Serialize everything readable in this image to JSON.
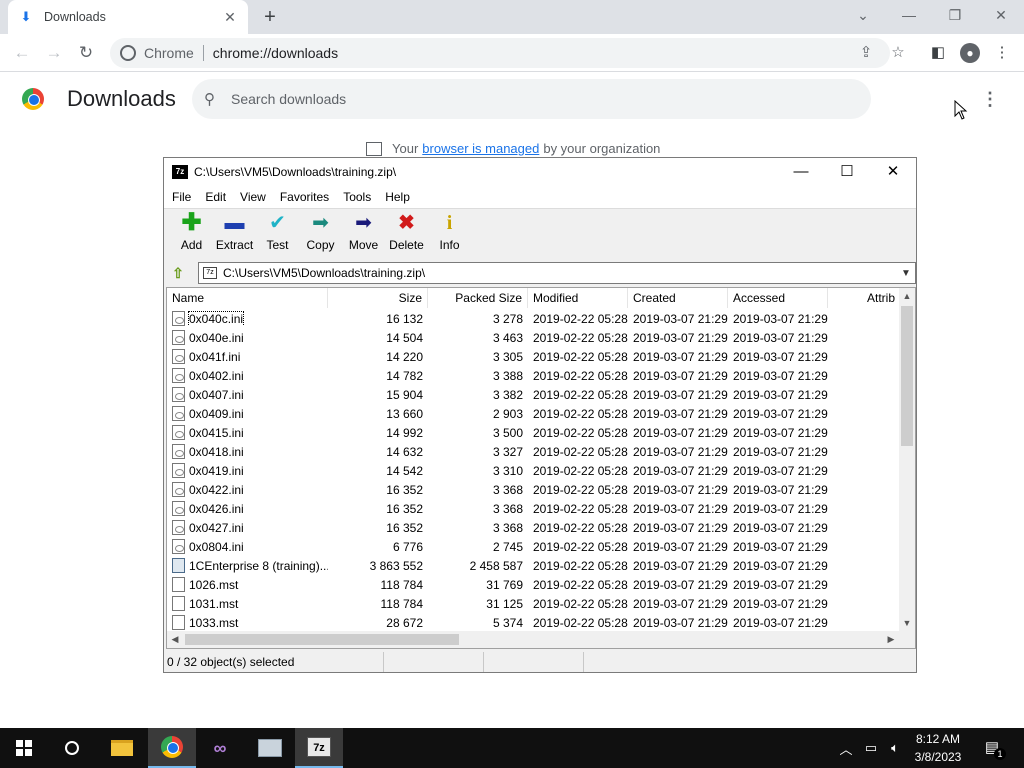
{
  "browser": {
    "tab_title": "Downloads",
    "newtab_symbol": "+",
    "omnibox_chip": "Chrome",
    "url": "chrome://downloads"
  },
  "downloads_page": {
    "title": "Downloads",
    "search_placeholder": "Search downloads",
    "managed_prefix": "Your",
    "managed_link": "browser is managed",
    "managed_suffix": "by your organization"
  },
  "sevenzip": {
    "title": "C:\\Users\\VM5\\Downloads\\training.zip\\",
    "menu": [
      "File",
      "Edit",
      "View",
      "Favorites",
      "Tools",
      "Help"
    ],
    "toolbar": [
      {
        "label": "Add",
        "icon": "plus-icon",
        "color": "#1aa31a"
      },
      {
        "label": "Extract",
        "icon": "minus-icon",
        "color": "#1e3fb0"
      },
      {
        "label": "Test",
        "icon": "check-icon",
        "color": "#1fb3c7"
      },
      {
        "label": "Copy",
        "icon": "double-arrow-icon",
        "color": "#1b8a7e"
      },
      {
        "label": "Move",
        "icon": "arrow-right-icon",
        "color": "#1a1a7a"
      },
      {
        "label": "Delete",
        "icon": "x-icon",
        "color": "#d11a1a"
      },
      {
        "label": "Info",
        "icon": "info-icon",
        "color": "#c9a400"
      }
    ],
    "path": "C:\\Users\\VM5\\Downloads\\training.zip\\",
    "columns": {
      "name": "Name",
      "size": "Size",
      "packed": "Packed Size",
      "modified": "Modified",
      "created": "Created",
      "accessed": "Accessed",
      "attrib": "Attrib"
    },
    "rows": [
      {
        "name": "0x040c.ini",
        "size": "16 132",
        "packed": "3 278",
        "modified": "2019-02-22 05:28",
        "created": "2019-03-07 21:29",
        "accessed": "2019-03-07 21:29",
        "type": "ini"
      },
      {
        "name": "0x040e.ini",
        "size": "14 504",
        "packed": "3 463",
        "modified": "2019-02-22 05:28",
        "created": "2019-03-07 21:29",
        "accessed": "2019-03-07 21:29",
        "type": "ini"
      },
      {
        "name": "0x041f.ini",
        "size": "14 220",
        "packed": "3 305",
        "modified": "2019-02-22 05:28",
        "created": "2019-03-07 21:29",
        "accessed": "2019-03-07 21:29",
        "type": "ini"
      },
      {
        "name": "0x0402.ini",
        "size": "14 782",
        "packed": "3 388",
        "modified": "2019-02-22 05:28",
        "created": "2019-03-07 21:29",
        "accessed": "2019-03-07 21:29",
        "type": "ini"
      },
      {
        "name": "0x0407.ini",
        "size": "15 904",
        "packed": "3 382",
        "modified": "2019-02-22 05:28",
        "created": "2019-03-07 21:29",
        "accessed": "2019-03-07 21:29",
        "type": "ini"
      },
      {
        "name": "0x0409.ini",
        "size": "13 660",
        "packed": "2 903",
        "modified": "2019-02-22 05:28",
        "created": "2019-03-07 21:29",
        "accessed": "2019-03-07 21:29",
        "type": "ini"
      },
      {
        "name": "0x0415.ini",
        "size": "14 992",
        "packed": "3 500",
        "modified": "2019-02-22 05:28",
        "created": "2019-03-07 21:29",
        "accessed": "2019-03-07 21:29",
        "type": "ini"
      },
      {
        "name": "0x0418.ini",
        "size": "14 632",
        "packed": "3 327",
        "modified": "2019-02-22 05:28",
        "created": "2019-03-07 21:29",
        "accessed": "2019-03-07 21:29",
        "type": "ini"
      },
      {
        "name": "0x0419.ini",
        "size": "14 542",
        "packed": "3 310",
        "modified": "2019-02-22 05:28",
        "created": "2019-03-07 21:29",
        "accessed": "2019-03-07 21:29",
        "type": "ini"
      },
      {
        "name": "0x0422.ini",
        "size": "16 352",
        "packed": "3 368",
        "modified": "2019-02-22 05:28",
        "created": "2019-03-07 21:29",
        "accessed": "2019-03-07 21:29",
        "type": "ini"
      },
      {
        "name": "0x0426.ini",
        "size": "16 352",
        "packed": "3 368",
        "modified": "2019-02-22 05:28",
        "created": "2019-03-07 21:29",
        "accessed": "2019-03-07 21:29",
        "type": "ini"
      },
      {
        "name": "0x0427.ini",
        "size": "16 352",
        "packed": "3 368",
        "modified": "2019-02-22 05:28",
        "created": "2019-03-07 21:29",
        "accessed": "2019-03-07 21:29",
        "type": "ini"
      },
      {
        "name": "0x0804.ini",
        "size": "6 776",
        "packed": "2 745",
        "modified": "2019-02-22 05:28",
        "created": "2019-03-07 21:29",
        "accessed": "2019-03-07 21:29",
        "type": "ini"
      },
      {
        "name": "1CEnterprise 8 (training)...",
        "size": "3 863 552",
        "packed": "2 458 587",
        "modified": "2019-02-22 05:28",
        "created": "2019-03-07 21:29",
        "accessed": "2019-03-07 21:29",
        "type": "pkg"
      },
      {
        "name": "1026.mst",
        "size": "118 784",
        "packed": "31 769",
        "modified": "2019-02-22 05:28",
        "created": "2019-03-07 21:29",
        "accessed": "2019-03-07 21:29",
        "type": "mst"
      },
      {
        "name": "1031.mst",
        "size": "118 784",
        "packed": "31 125",
        "modified": "2019-02-22 05:28",
        "created": "2019-03-07 21:29",
        "accessed": "2019-03-07 21:29",
        "type": "mst"
      },
      {
        "name": "1033.mst",
        "size": "28 672",
        "packed": "5 374",
        "modified": "2019-02-22 05:28",
        "created": "2019-03-07 21:29",
        "accessed": "2019-03-07 21:29",
        "type": "mst"
      }
    ],
    "status": "0 / 32 object(s) selected"
  },
  "taskbar": {
    "time": "8:12 AM",
    "date": "3/8/2023",
    "notification_count": "1",
    "app_7zip_label": "7z"
  }
}
